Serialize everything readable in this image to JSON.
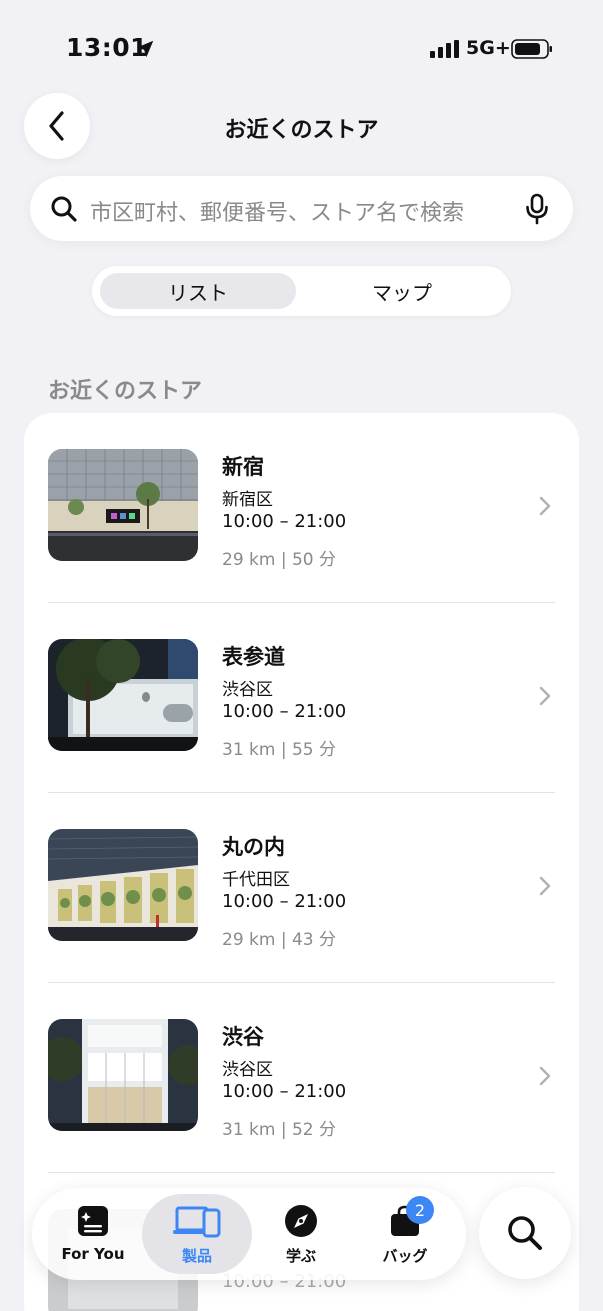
{
  "status_bar": {
    "time": "13:01",
    "network": "5G+"
  },
  "header": {
    "title": "お近くのストア"
  },
  "search": {
    "placeholder": "市区町村、郵便番号、ストア名で検索"
  },
  "view_toggle": {
    "list_label": "リスト",
    "map_label": "マップ",
    "selected": "リスト"
  },
  "section": {
    "heading": "お近くのストア"
  },
  "stores": [
    {
      "name": "新宿",
      "district": "新宿区",
      "hours": "10:00 – 21:00",
      "distance": "29 km | 50 分"
    },
    {
      "name": "表参道",
      "district": "渋谷区",
      "hours": "10:00 – 21:00",
      "distance": "31 km | 55 分"
    },
    {
      "name": "丸の内",
      "district": "千代田区",
      "hours": "10:00 – 21:00",
      "distance": "29 km | 43 分"
    },
    {
      "name": "渋谷",
      "district": "渋谷区",
      "hours": "10:00 – 21:00",
      "distance": "31 km | 52 分"
    },
    {
      "hours": "10:00 – 21:00"
    }
  ],
  "tab_bar": {
    "tabs": [
      {
        "label": "For You",
        "icon": "for-you-icon"
      },
      {
        "label": "製品",
        "icon": "devices-icon",
        "selected": true
      },
      {
        "label": "学ぶ",
        "icon": "compass-icon"
      },
      {
        "label": "バッグ",
        "icon": "bag-icon",
        "badge": "2"
      }
    ]
  },
  "colors": {
    "accent": "#3d87f5",
    "background": "#f2f2f6",
    "secondary_text": "#8a8a8e"
  }
}
